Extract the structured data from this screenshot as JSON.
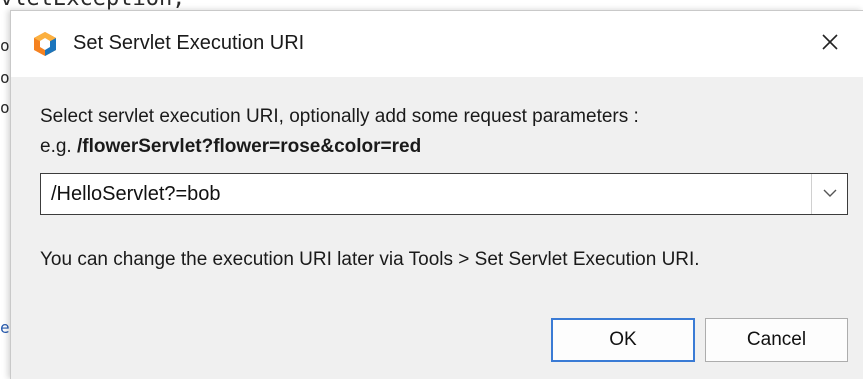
{
  "background": {
    "code_fragment": "vletException;",
    "gutter_chars": [
      "o",
      "o",
      "o"
    ],
    "gutter_blue": "e:"
  },
  "dialog": {
    "title": "Set Servlet Execution URI",
    "close_label": "×",
    "instruction": "Select servlet execution URI, optionally add some request parameters :",
    "example_prefix": "e.g. ",
    "example_value": "/flowerServlet?flower=rose&color=red",
    "uri_value": "/HelloServlet?=bob",
    "hint": "You can change the execution URI later via Tools > Set Servlet Execution URI.",
    "ok_label": "OK",
    "cancel_label": "Cancel"
  },
  "colors": {
    "dialog_bg": "#f0f0f0",
    "titlebar_bg": "#ffffff",
    "default_button_border": "#3a7bd5",
    "logo_orange": "#f58220",
    "logo_blue": "#1c75bc"
  },
  "icons": {
    "app_logo": "netbeans-logo-icon",
    "close": "close-icon",
    "dropdown": "chevron-down-icon"
  }
}
